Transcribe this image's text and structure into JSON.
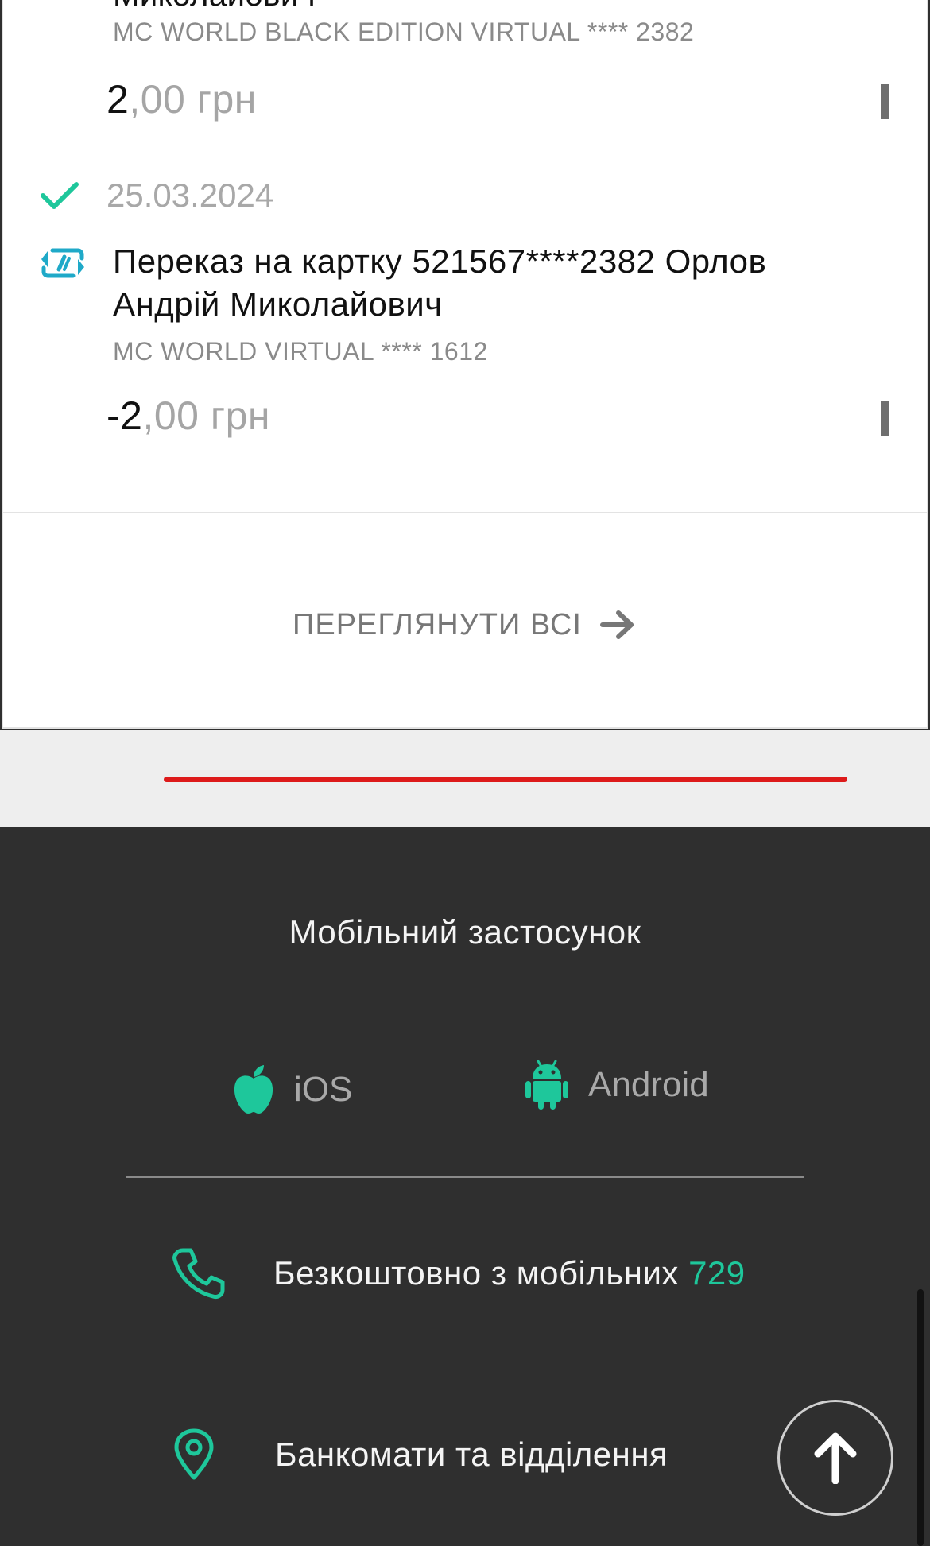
{
  "transactions": [
    {
      "name_clipped": "Миколайович",
      "card": "MC WORLD BLACK EDITION VIRTUAL **** 2382",
      "amount": {
        "int": "2",
        "dec": ",00",
        "currency": " грн"
      }
    },
    {
      "date": "25.03.2024",
      "title": "Переказ на картку 521567****2382 Орлов Андрій Миколайович",
      "card": "MC WORLD VIRTUAL **** 1612",
      "amount": {
        "int": "-2",
        "dec": ",00",
        "currency": " грн"
      }
    }
  ],
  "view_all_label": "ПЕРЕГЛЯНУТИ ВСІ",
  "footer": {
    "title": "Мобільний застосунок",
    "ios_label": "iOS",
    "android_label": "Android",
    "phone_text": "Безкоштовно з мобільних ",
    "phone_number": "729",
    "atm_text": "Банкомати та відділення"
  },
  "icons": {
    "check": "check-icon",
    "transfer": "transfer-icon",
    "arrow_right": "arrow-right-icon",
    "apple": "apple-icon",
    "android": "android-icon",
    "phone": "phone-icon",
    "location": "location-pin-icon",
    "arrow_up": "arrow-up-icon"
  },
  "colors": {
    "accent_green": "#1ec79b",
    "teal_icon": "#1fa9c8",
    "brand_red": "#dd1a1a",
    "footer_bg": "#2f2f2f"
  }
}
